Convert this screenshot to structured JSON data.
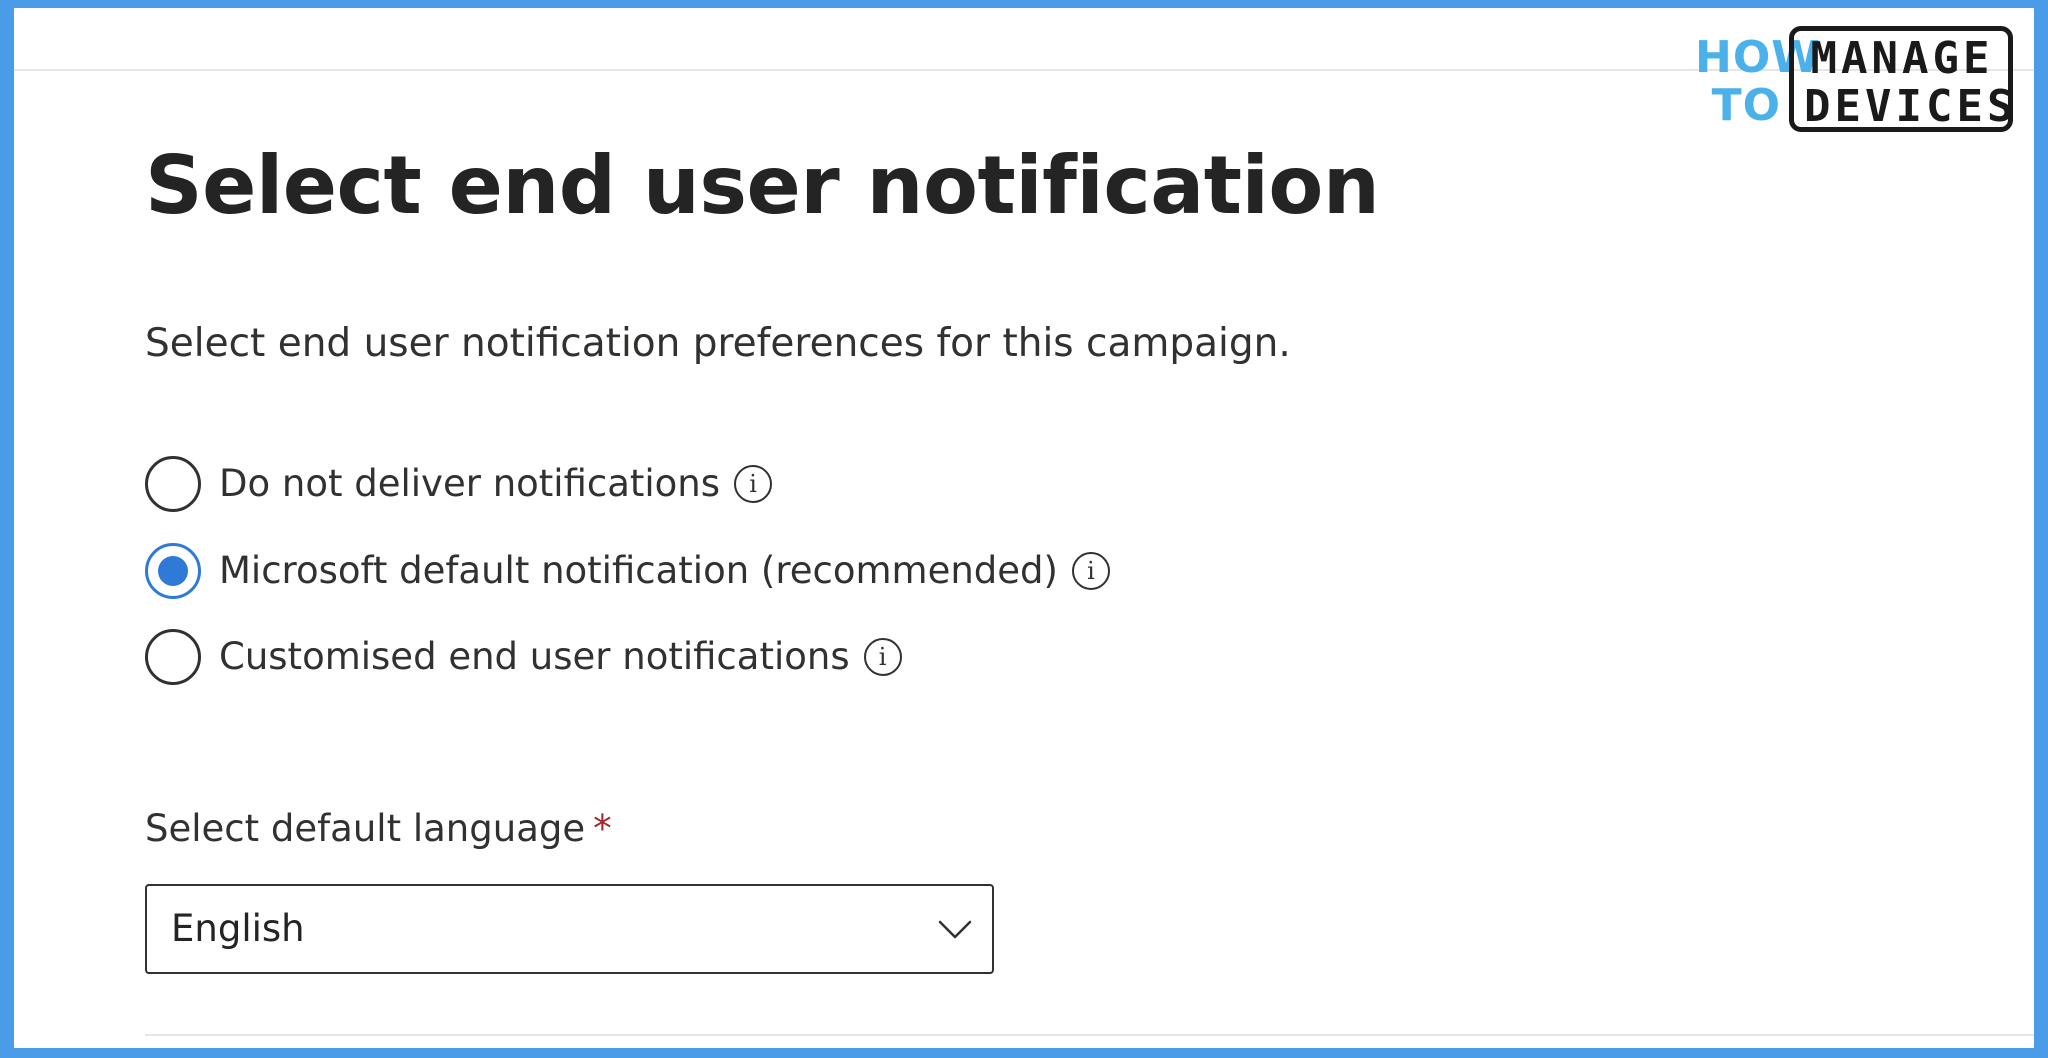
{
  "logo": {
    "how": "HOW",
    "to": "TO",
    "manage": "MANAGE",
    "devices": "DEVICES",
    "brand_color": "#4ab1ea"
  },
  "page": {
    "title": "Select end user notification",
    "subtitle": "Select end user notification preferences for this campaign."
  },
  "notification_options": {
    "selected_index": 1,
    "items": [
      {
        "label": "Do not deliver notifications",
        "selected": false,
        "icon": "info-icon"
      },
      {
        "label": "Microsoft default notification (recommended)",
        "selected": true,
        "icon": "info-icon"
      },
      {
        "label": "Customised end user notifications",
        "selected": false,
        "icon": "info-icon"
      }
    ]
  },
  "language": {
    "label": "Select default language",
    "required_marker": "*",
    "selected": "English",
    "icon": "chevron-down-icon"
  },
  "colors": {
    "accent": "#2f7ad6",
    "frame": "#4a9be8",
    "required": "#a4262c",
    "text": "#323130"
  }
}
